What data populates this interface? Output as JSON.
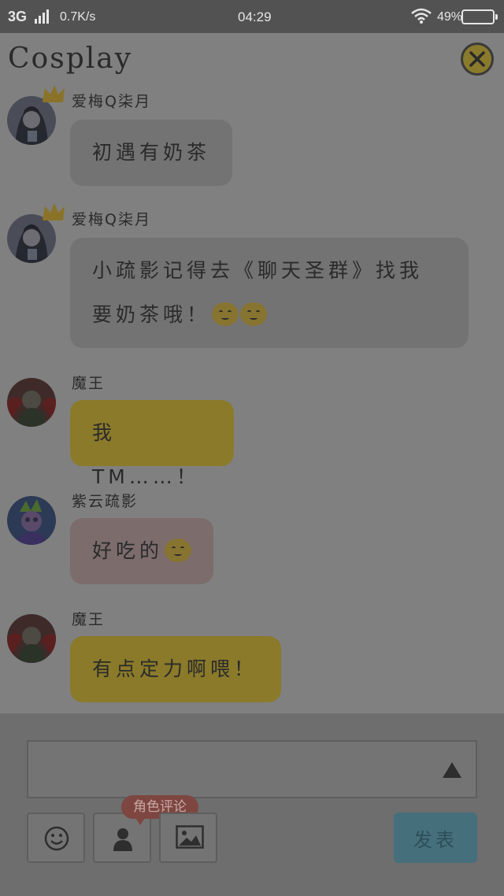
{
  "status_bar": {
    "network": "3G",
    "speed": "0.7K/s",
    "time": "04:29",
    "battery": "49%"
  },
  "header": {
    "title": "Cosplay"
  },
  "messages": [
    {
      "user": "爱梅Q柒月",
      "text": "初遇有奶茶",
      "line2": ""
    },
    {
      "user": "爱梅Q柒月",
      "text": "小疏影记得去《聊天圣群》找我",
      "line2": "要奶茶哦！"
    },
    {
      "user": "魔王",
      "text": "我TM……！",
      "line2": ""
    },
    {
      "user": "紫云疏影",
      "text": "好吃的",
      "line2": ""
    },
    {
      "user": "魔王",
      "text": "有点定力啊喂！",
      "line2": ""
    }
  ],
  "composer": {
    "input_value": "",
    "role_tag": "角色评论",
    "send_label": "发表"
  },
  "colors": {
    "gold_bubble": "#8a7a2a",
    "grey_bubble": "#737373",
    "pink_bubble": "#7c6c6c",
    "send_button": "#466f7c",
    "role_tag": "#7e4640"
  },
  "icons": [
    "close-icon",
    "crown-icon",
    "emoji-icon",
    "smiley-icon",
    "person-icon",
    "image-icon",
    "expand-up-icon",
    "wifi-icon",
    "signal-icon",
    "battery-icon"
  ]
}
